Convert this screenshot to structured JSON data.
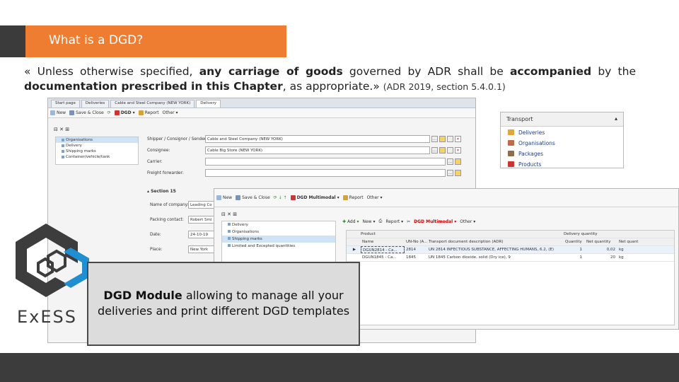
{
  "slide": {
    "title": "What is a DGD?",
    "quote_open": "« Unless otherwise specified, ",
    "quote_bold1": "any carriage of goods",
    "quote_mid1": " governed by ADR shall be ",
    "quote_bold2": "accompanied",
    "quote_mid2": " by the ",
    "quote_bold3": "documentation prescribed in this Chapter",
    "quote_end": ", as appropriate.» ",
    "quote_source": "(ADR 2019, section 5.4.0.1)",
    "callout_bold": "DGD Module",
    "callout_text": " allowing to manage all your deliveries and print different DGD templates",
    "logo_text": "ExESS"
  },
  "colors": {
    "accent": "#ee7d31",
    "dark": "#3b3b3b",
    "logo_blue": "#1f8fd1"
  },
  "win1": {
    "tabs": [
      "Start page",
      "Deliveries",
      "Cable and Steel Company (NEW YORK)",
      "Delivery"
    ],
    "toolbar": [
      "New",
      "Save & Close",
      "DGD",
      "Report",
      "Other"
    ],
    "tree": [
      "Organisations",
      "Delivery",
      "Shipping marks",
      "Container/vehicle/tank"
    ],
    "fields": [
      {
        "label": "Shipper / Consignor / Sender:",
        "value": "Cable and Steel Company (NEW YORK)"
      },
      {
        "label": "Consignee:",
        "value": "Cable Big Store (NEW YORK)"
      },
      {
        "label": "Carrier:",
        "value": ""
      },
      {
        "label": "Freight forwarder:",
        "value": ""
      }
    ],
    "section_title": "Section 15",
    "section_fields": [
      {
        "label": "Name of company:",
        "value": "Leading Co"
      },
      {
        "label": "Packing contact:",
        "value": "Robert Smi"
      },
      {
        "label": "Date:",
        "value": "24-10-19"
      },
      {
        "label": "Place:",
        "value": "New York"
      }
    ]
  },
  "transport": {
    "title": "Transport",
    "items": [
      "Deliveries",
      "Organisations",
      "Packages",
      "Products"
    ]
  },
  "win2": {
    "toolbar": [
      "New",
      "Save & Close",
      "DGD Multimodal",
      "Report",
      "Other"
    ],
    "tree": [
      "Delivery",
      "Organisations",
      "Shipping marks",
      "Limited and Excepted quantities"
    ],
    "grid_toolbar": [
      "Add",
      "New",
      "Report",
      "DGD Multimodal",
      "Other"
    ],
    "group_product": "Product",
    "group_delivery": "Delivery quantity",
    "columns": [
      "Name",
      "UN-No (A...",
      "Transport document description (ADR)",
      "Quantity",
      "Net quantity",
      "Net quant"
    ],
    "rows": [
      [
        "DGUN2814 - Ca...",
        "2814",
        "UN 2814 INFECTIOUS SUBSTANCE, AFFECTING HUMANS, 6.2, (E)",
        "1",
        "0,02",
        "kg"
      ],
      [
        "DGUN1845 - Ca...",
        "1845",
        "UN 1845 Carbon dioxide, solid (Dry ice), 9",
        "1",
        "20",
        "kg"
      ]
    ]
  }
}
